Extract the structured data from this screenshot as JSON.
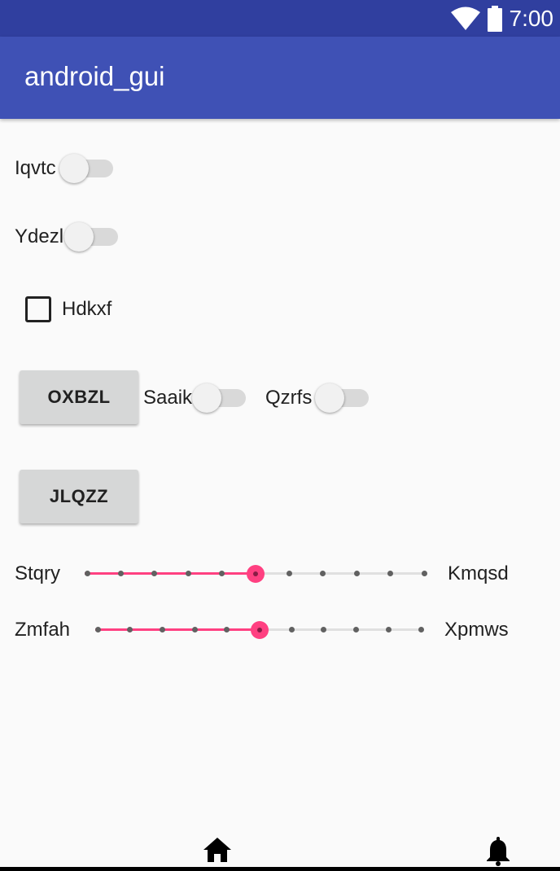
{
  "status_bar": {
    "time": "7:00",
    "wifi_icon": "wifi-icon",
    "battery_icon": "battery-icon",
    "color": "#303f9f"
  },
  "app_bar": {
    "title": "android_gui",
    "color": "#3f51b5"
  },
  "switches": [
    {
      "label": "Iqvtc",
      "checked": false
    },
    {
      "label": "Ydezl",
      "checked": false
    },
    {
      "label": "Saaik",
      "checked": false
    },
    {
      "label": "Qzrfs",
      "checked": false
    }
  ],
  "checkbox": {
    "label": "Hdkxf",
    "checked": false
  },
  "buttons": [
    {
      "label": "OXBZL"
    },
    {
      "label": "JLQZZ"
    }
  ],
  "sliders": [
    {
      "left_label": "Stqry",
      "right_label": "Kmqsd",
      "value": 5,
      "max": 10
    },
    {
      "left_label": "Zmfah",
      "right_label": "Xpmws",
      "value": 5,
      "max": 10
    }
  ],
  "accent_color": "#ff4081",
  "bottom_nav": {
    "home_icon": "home-icon",
    "notifications_icon": "bell-icon"
  }
}
